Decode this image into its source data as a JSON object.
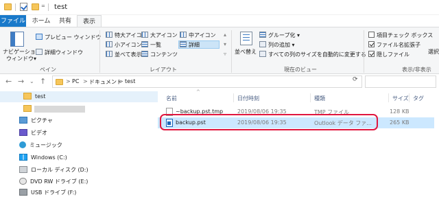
{
  "window": {
    "title": "test",
    "quick_access_more": "="
  },
  "tabs": [
    {
      "label": "ファイル"
    },
    {
      "label": "ホーム"
    },
    {
      "label": "共有"
    },
    {
      "label": "表示"
    }
  ],
  "ribbon": {
    "pane": {
      "nav_pane_label_1": "ナビゲーション",
      "nav_pane_label_2": "ウィンドウ▾",
      "preview": "プレビュー ウィンドウ",
      "details": "詳細ウィンドウ",
      "group": "ペイン"
    },
    "layout": {
      "items": [
        "特大アイコン",
        "大アイコン",
        "中アイコン",
        "小アイコン",
        "一覧",
        "詳細",
        "並べて表示",
        "コンテンツ"
      ],
      "group": "レイアウト"
    },
    "current_view": {
      "sort": "並べ替え",
      "group_by": "グループ化 ▾",
      "add_columns": "列の追加 ▾",
      "fit_columns": "すべての列のサイズを自動的に変更する",
      "group": "現在のビュー"
    },
    "show_hide": {
      "item_checkboxes": "項目チェック ボックス",
      "file_extensions": "ファイル名拡張子",
      "hidden_items": "隠しファイル",
      "hide_selected": "選択",
      "group": "表示/非表示"
    }
  },
  "address": {
    "crumbs": [
      "PC",
      "ドキュメント",
      "test"
    ],
    "separator": ">"
  },
  "nav_pane": {
    "items": [
      {
        "label": "test",
        "icon": "folder-icon"
      },
      {
        "label": "",
        "icon": "folder-icon"
      },
      {
        "label": "ピクチャ",
        "icon": "pictures-icon"
      },
      {
        "label": "ビデオ",
        "icon": "videos-icon"
      },
      {
        "label": "ミュージック",
        "icon": "music-icon"
      },
      {
        "label": "Windows (C:)",
        "icon": "windows-drive-icon"
      },
      {
        "label": "ローカル ディスク (D:)",
        "icon": "drive-icon"
      },
      {
        "label": "DVD RW ドライブ (E:)",
        "icon": "dvd-drive-icon"
      },
      {
        "label": "USB ドライブ (F:)",
        "icon": "usb-drive-icon"
      }
    ]
  },
  "file_list": {
    "columns": [
      "名前",
      "日付時刻",
      "種類",
      "サイズ",
      "タグ"
    ],
    "rows": [
      {
        "name": "~backup.pst.tmp",
        "date": "2019/08/06 19:35",
        "type": "TMP ファイル",
        "size": "128 KB",
        "selected": false
      },
      {
        "name": "backup.pst",
        "date": "2019/08/06 19:35",
        "type": "Outlook データ ファ...",
        "size": "265 KB",
        "selected": true
      }
    ]
  },
  "colors": {
    "accent": "#1979ca",
    "selection": "#cce8ff",
    "highlight": "#e0163e"
  }
}
